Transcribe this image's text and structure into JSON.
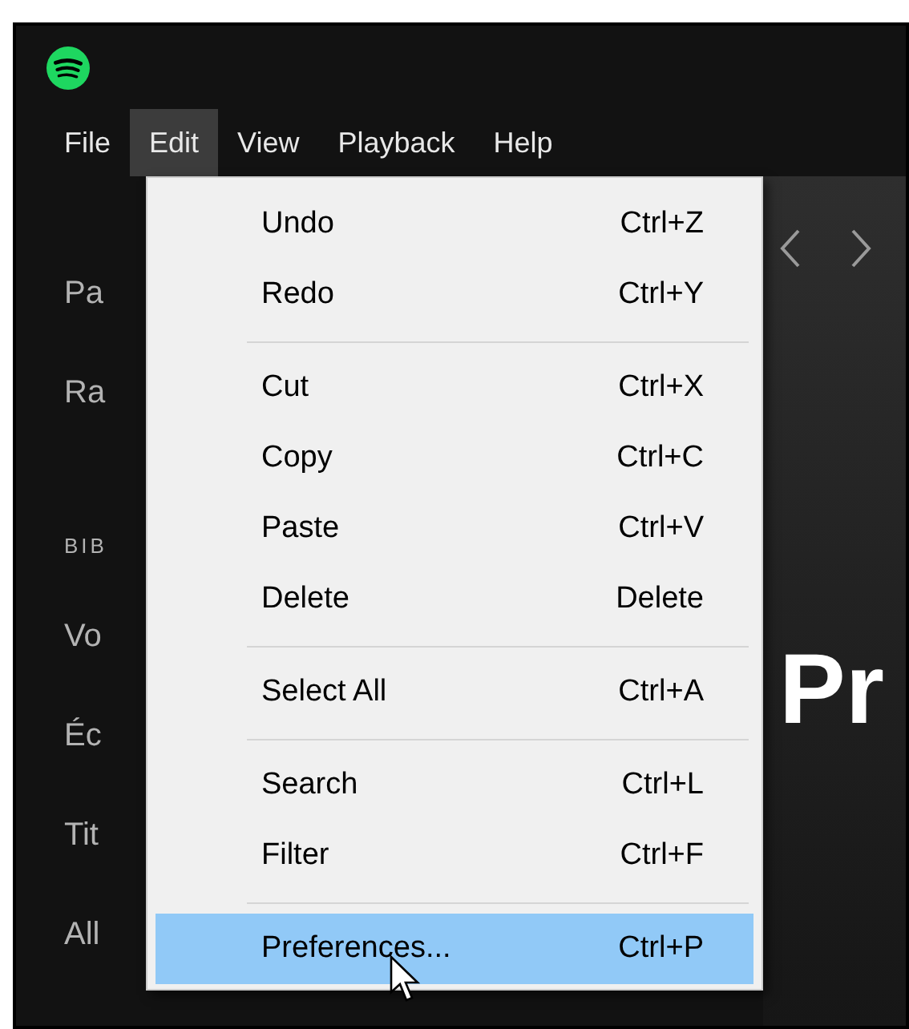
{
  "menu_bar": [
    {
      "label": "File",
      "selected": false
    },
    {
      "label": "Edit",
      "selected": true
    },
    {
      "label": "View",
      "selected": false
    },
    {
      "label": "Playback",
      "selected": false
    },
    {
      "label": "Help",
      "selected": false
    }
  ],
  "sidebar": {
    "items": [
      {
        "kind": "item",
        "label": "Pa"
      },
      {
        "kind": "item",
        "label": "Ra"
      },
      {
        "kind": "header",
        "label": "BIB"
      },
      {
        "kind": "item",
        "label": "Vo"
      },
      {
        "kind": "item",
        "label": "Éc"
      },
      {
        "kind": "item",
        "label": "Tit"
      },
      {
        "kind": "item",
        "label": "All"
      }
    ]
  },
  "main": {
    "heading": "Pr"
  },
  "edit_menu": {
    "groups": [
      [
        {
          "label": "Undo",
          "shortcut": "Ctrl+Z",
          "selected": false
        },
        {
          "label": "Redo",
          "shortcut": "Ctrl+Y",
          "selected": false
        }
      ],
      [
        {
          "label": "Cut",
          "shortcut": "Ctrl+X",
          "selected": false
        },
        {
          "label": "Copy",
          "shortcut": "Ctrl+C",
          "selected": false
        },
        {
          "label": "Paste",
          "shortcut": "Ctrl+V",
          "selected": false
        },
        {
          "label": "Delete",
          "shortcut": "Delete",
          "selected": false
        }
      ],
      [
        {
          "label": "Select All",
          "shortcut": "Ctrl+A",
          "selected": false
        }
      ],
      [
        {
          "label": "Search",
          "shortcut": "Ctrl+L",
          "selected": false
        },
        {
          "label": "Filter",
          "shortcut": "Ctrl+F",
          "selected": false
        }
      ],
      [
        {
          "label": "Preferences...",
          "shortcut": "Ctrl+P",
          "selected": true
        }
      ]
    ]
  }
}
